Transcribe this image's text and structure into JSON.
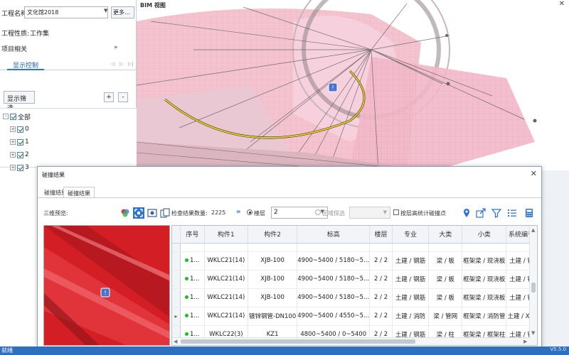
{
  "project": {
    "name_label": "工程名称:",
    "name_value": "文化馆2018",
    "more_button": "更多…",
    "nature_label": "工程性质:",
    "nature_value": "工作集",
    "related_label": "项目相关",
    "display_tab": "显示控制",
    "filter_button": "显示筛选",
    "plus": "+",
    "minus": "-",
    "tree": [
      {
        "label": "全部",
        "expander": "-"
      },
      {
        "label": "0",
        "expander": "+"
      },
      {
        "label": "1",
        "expander": "+"
      },
      {
        "label": "2",
        "expander": "+"
      },
      {
        "label": "3",
        "expander": "+"
      }
    ]
  },
  "bim": {
    "title": "BIM 视图",
    "close": "✕"
  },
  "dialog": {
    "title": "碰撞结果",
    "close": "✕",
    "tabs": [
      "碰撞结果",
      "碰撞结果"
    ],
    "preview_label": "三维预览:",
    "count_label": "检查结果数量:",
    "count_value": "2225",
    "floor_label": "楼层",
    "floor_value": "2",
    "area_label": "区域保选",
    "floor_check_label": "按层高统计碰撞点",
    "columns": [
      "序号",
      "构件1",
      "构件2",
      "标高",
      "楼层",
      "专业",
      "大类",
      "小类",
      "系统编号"
    ],
    "rows": [
      {
        "seq": "1...",
        "c1": "WKLC21(14)",
        "c2": "XJB-100",
        "elev": "4900~5400 / 5180~5...",
        "floor": "2 / 2",
        "major": "土建 / 钢筋",
        "cat": "梁 / 板",
        "sub": "框架梁 / 现浇板",
        "sys": "土建 / 钢",
        "current": false
      },
      {
        "seq": "1...",
        "c1": "WKLC21(14)",
        "c2": "XJB-100",
        "elev": "4900~5400 / 5180~5...",
        "floor": "2 / 2",
        "major": "土建 / 钢筋",
        "cat": "梁 / 板",
        "sub": "框架梁 / 现浇板",
        "sys": "土建 / 钢",
        "current": false
      },
      {
        "seq": "1...",
        "c1": "WKLC21(14)",
        "c2": "XJB-100",
        "elev": "4900~5400 / 5180~5...",
        "floor": "2 / 2",
        "major": "土建 / 钢筋",
        "cat": "梁 / 板",
        "sub": "框架梁 / 现浇板",
        "sys": "土建 / 钢",
        "current": false
      },
      {
        "seq": "1...",
        "c1": "WKLC21(14)",
        "c2": "镀锌钢管-DN100",
        "elev": "4900~5400 / 4550~5...",
        "floor": "2 / 2",
        "major": "土建 / 消防",
        "cat": "梁 / 管网",
        "sub": "框架梁 / 消防管",
        "sys": "土建 / XF-",
        "current": true
      },
      {
        "seq": "1...",
        "c1": "WKLC22(3)",
        "c2": "KZ1",
        "elev": "4800~5400 / 0~5400",
        "floor": "2 / 2",
        "major": "土建 / 钢筋",
        "cat": "梁 / 柱",
        "sub": "框架梁 / 框架柱",
        "sys": "土建 / 钢"
      }
    ],
    "current_marker": "▸"
  },
  "status": {
    "text": "就绪",
    "version": "V5.5.0"
  },
  "colors": {
    "accent": "#2e74d6",
    "status_bar": "#2f6fbf",
    "clash_red": "#d81e24",
    "row_dot": "#16c216"
  }
}
